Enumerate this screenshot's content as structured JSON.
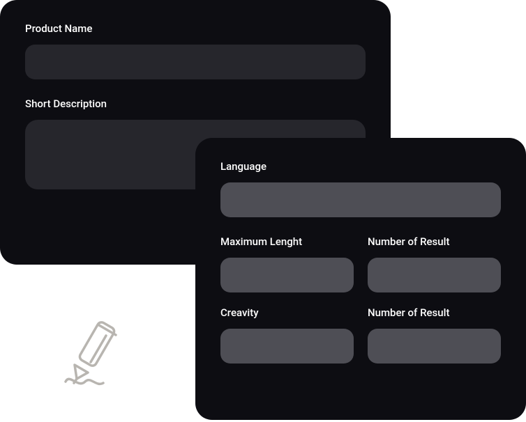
{
  "card_back": {
    "field1_label": "Product Name",
    "field2_label": "Short Description"
  },
  "card_front": {
    "field1_label": "Language",
    "field2_label": "Maximum Lenght",
    "field3_label": "Number of Result",
    "field4_label": "Creavity",
    "field5_label": "Number of Result"
  },
  "icon": {
    "name": "pencil-doodle-icon"
  }
}
